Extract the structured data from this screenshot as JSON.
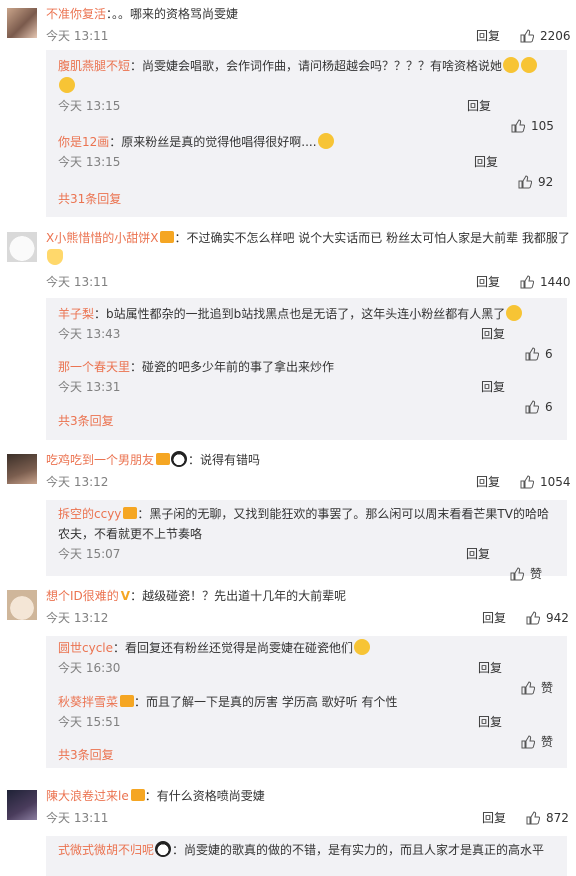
{
  "comments": [
    {
      "user": "不准你复活",
      "text": "：。。哪来的资格骂尚雯婕",
      "time": "今天 13:11",
      "reply_label": "回复",
      "likes": "2206",
      "replies": [
        {
          "user": "腹肌燕腿不短",
          "text": "：尚雯婕会唱歌，会作词作曲，请问杨超越会吗？？？？有啥资格说她",
          "time": "今天 13:15",
          "reply_label": "回复",
          "likes": "105"
        },
        {
          "user": "你是12画",
          "text": "：原来粉丝是真的觉得他唱得很好啊....",
          "time": "今天 13:15",
          "reply_label": "回复",
          "likes": "92"
        }
      ],
      "more": "共31条回复"
    },
    {
      "user": "X小熊惜惜的小甜饼X",
      "text": "：不过确实不怎么样吧 说个大实话而已 粉丝太可怕人家是大前辈 我都服了",
      "time": "今天 13:11",
      "reply_label": "回复",
      "likes": "1440",
      "replies": [
        {
          "user": "羊子梨",
          "text": "：b站属性都杂的一批追到b站找黑点也是无语了，这年头连小粉丝都有人黑了",
          "time": "今天 13:43",
          "reply_label": "回复",
          "likes": "6"
        },
        {
          "user": "那一个春天里",
          "text": "：碰瓷的吧多少年前的事了拿出来炒作",
          "time": "今天 13:31",
          "reply_label": "回复",
          "likes": "6"
        }
      ],
      "more": "共3条回复"
    },
    {
      "user": "吃鸡吃到一个男朋友",
      "text": "：说得有错吗",
      "time": "今天 13:12",
      "reply_label": "回复",
      "likes": "1054",
      "replies": [
        {
          "user": "拆空的ccyy",
          "text": "：黑子闲的无聊，又找到能狂欢的事罢了。那么闲可以周末看看芒果TV的哈哈农夫，不看就更不上节奏咯",
          "time": "今天 15:07",
          "reply_label": "回复",
          "likes": "赞"
        }
      ]
    },
    {
      "user": "想个ID很难的",
      "text": "：越级碰瓷！？先出道十几年的大前辈呢",
      "time": "今天 13:12",
      "reply_label": "回复",
      "likes": "942",
      "replies": [
        {
          "user": "圆世cycle",
          "text": "：看回复还有粉丝还觉得是尚雯婕在碰瓷他们",
          "time": "今天 16:30",
          "reply_label": "回复",
          "likes": "赞"
        },
        {
          "user": "秋葵拌雪菜",
          "text": "：而且了解一下是真的厉害 学历高 歌好听 有个性",
          "time": "今天 15:51",
          "reply_label": "回复",
          "likes": "赞"
        }
      ],
      "more": "共3条回复"
    },
    {
      "user": "陳大浪卷过来le",
      "text": "：有什么资格喷尚雯婕",
      "time": "今天 13:11",
      "reply_label": "回复",
      "likes": "872",
      "replies": [
        {
          "user": "式微式微胡不归呢",
          "text": "：尚雯婕的歌真的做的不错，是有实力的，而且人家才是真正的高水平"
        }
      ]
    }
  ]
}
